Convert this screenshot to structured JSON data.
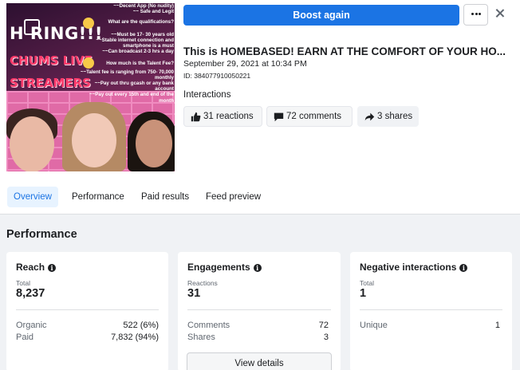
{
  "thumbnail": {
    "hiring": "H RING!!!",
    "chums": [
      "CHUMS LIVE",
      "STREAMERS"
    ],
    "lines": [
      "~~Decent App (No nudity)",
      "~~ Safe and Legit",
      "What are the qualifications?",
      "~~Must be 17- 30 years old",
      "~~Stable internet connection and",
      "smartphone is a must",
      "~~Can broadcast 2-3 hrs a day",
      "",
      "How much is the Talent Fee?",
      "~~Talent fee is ranging from 750- 70,000",
      "monthly",
      "~~Pay out thru gcash or any bank",
      "account",
      "~~Pay out every 15th and end of the",
      "month"
    ]
  },
  "actions": {
    "boost_label": "Boost again",
    "more_icon": "more-dots-icon",
    "close_icon": "close-icon"
  },
  "post": {
    "title": "This is HOMEBASED! EARN AT THE COMFORT OF YOUR HO...",
    "date": "September 29, 2021 at 10:34 PM",
    "id": "ID: 384077910050221"
  },
  "interactions": {
    "label": "Interactions",
    "reactions": "31 reactions",
    "comments": "72 comments",
    "shares": "3 shares"
  },
  "tabs": [
    "Overview",
    "Performance",
    "Paid results",
    "Feed preview"
  ],
  "performance": {
    "title": "Performance",
    "reach": {
      "title": "Reach",
      "label": "Total",
      "value": "8,237",
      "rows": [
        {
          "label": "Organic",
          "value": "522 (6%)"
        },
        {
          "label": "Paid",
          "value": "7,832 (94%)"
        }
      ]
    },
    "engagements": {
      "title": "Engagements",
      "label": "Reactions",
      "value": "31",
      "rows": [
        {
          "label": "Comments",
          "value": "72"
        },
        {
          "label": "Shares",
          "value": "3"
        }
      ],
      "button": "View details"
    },
    "negative": {
      "title": "Negative interactions",
      "label": "Total",
      "value": "1",
      "rows": [
        {
          "label": "Unique",
          "value": "1"
        }
      ]
    }
  },
  "colors": {
    "accent": "#1b74e4",
    "tab_active_bg": "#e7f3ff",
    "section_bg": "#f0f2f5"
  }
}
